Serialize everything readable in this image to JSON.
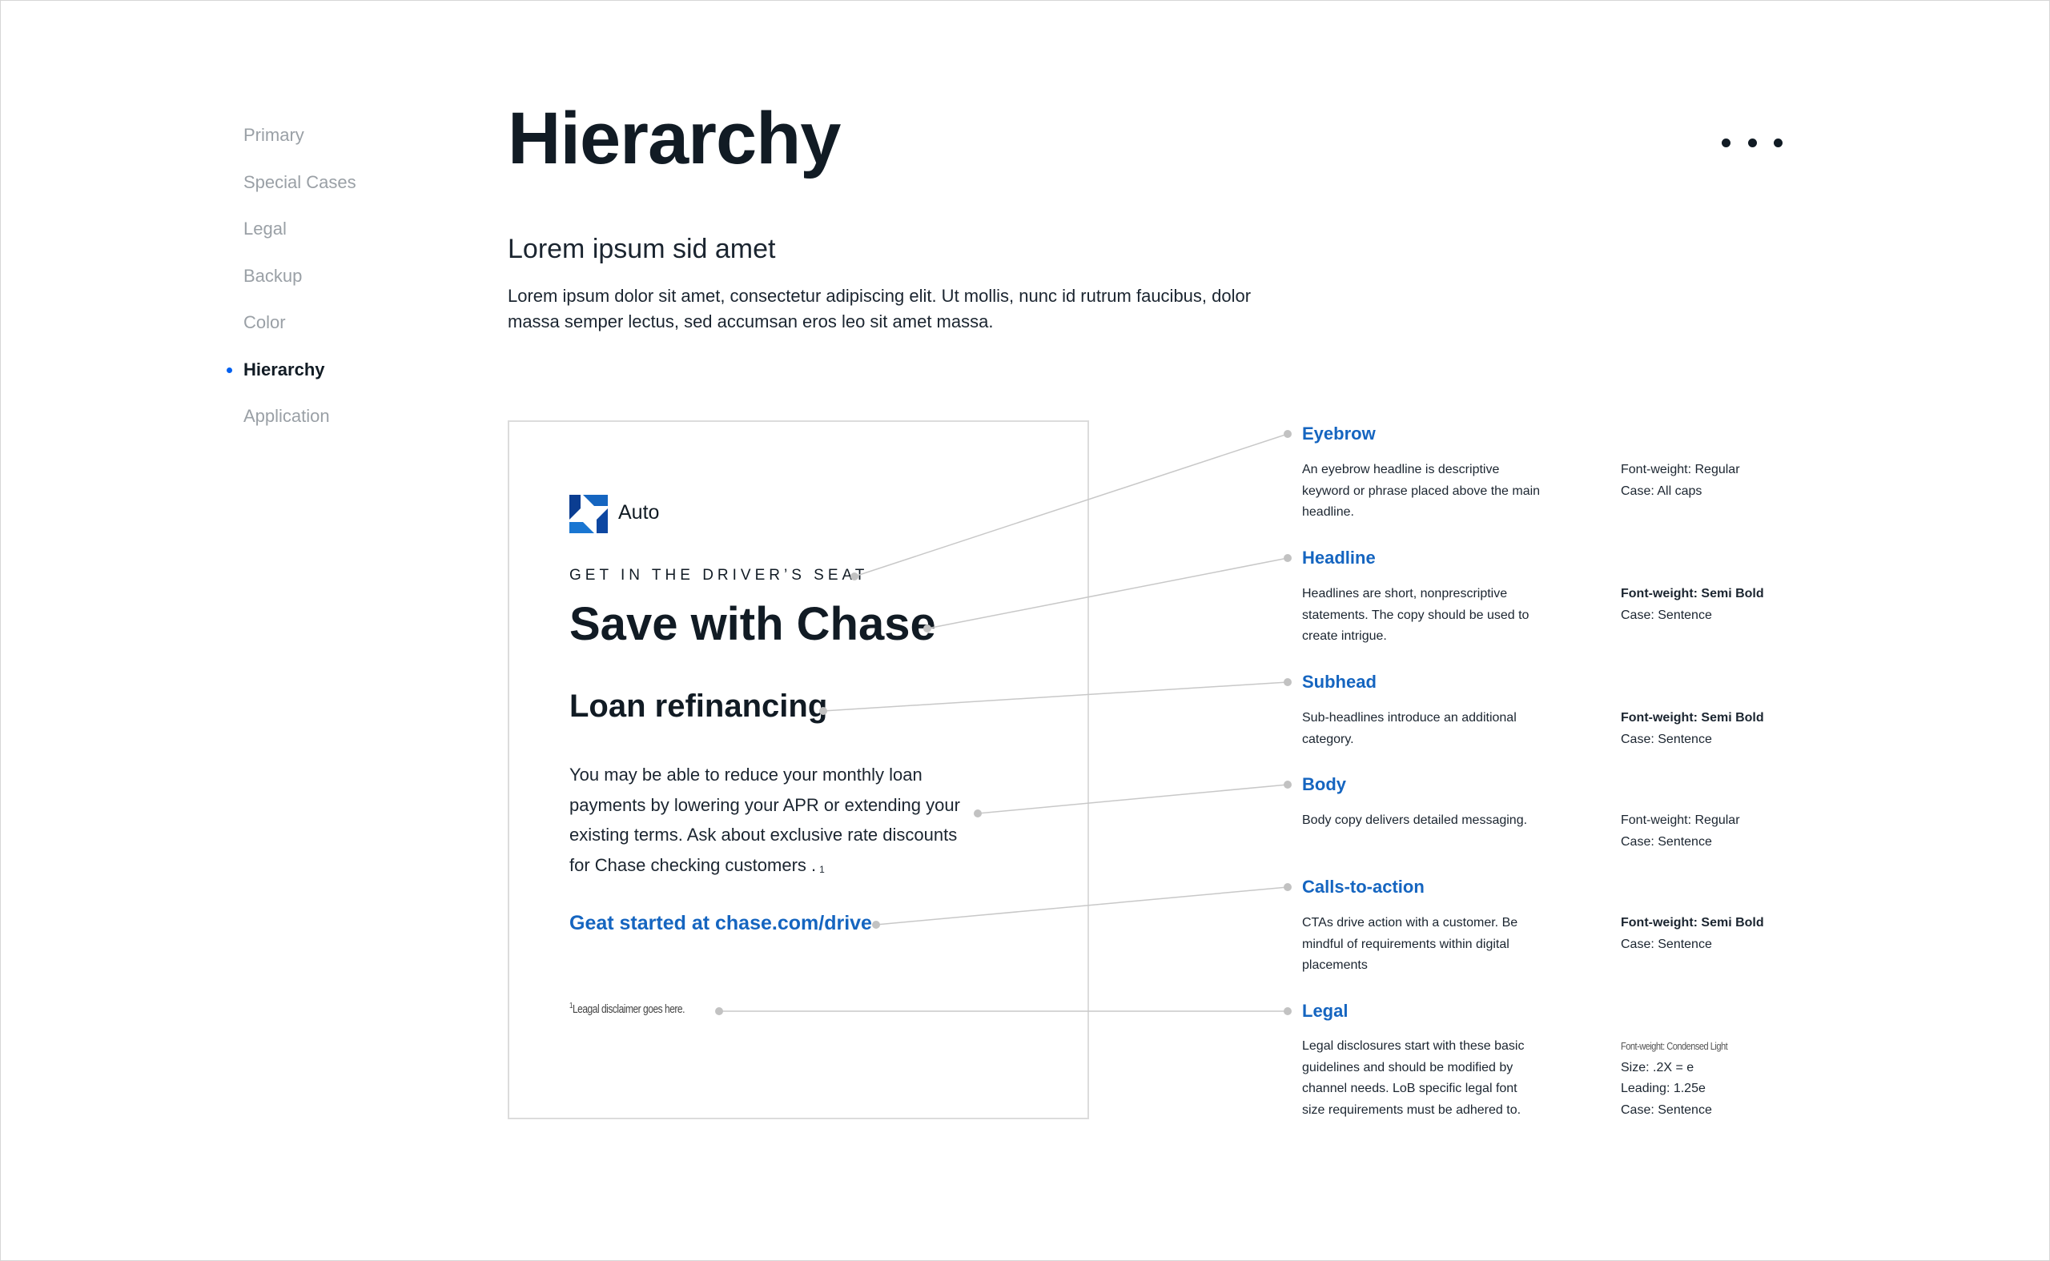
{
  "sidebar": {
    "items": [
      {
        "label": "Primary"
      },
      {
        "label": "Special Cases"
      },
      {
        "label": "Legal"
      },
      {
        "label": "Backup"
      },
      {
        "label": "Color"
      },
      {
        "label": "Hierarchy",
        "active": true
      },
      {
        "label": "Application"
      }
    ]
  },
  "header": {
    "title": "Hierarchy",
    "more_icon": "more-horizontal-icon"
  },
  "intro": {
    "subtitle": "Lorem ipsum sid amet",
    "body": "Lorem ipsum dolor sit amet, consectetur adipiscing elit. Ut mollis, nunc id rutrum faucibus, dolor massa semper lectus, sed accumsan eros leo sit amet massa."
  },
  "ad": {
    "logo_icon": "chase-octagon-logo-icon",
    "logo_label": "Auto",
    "eyebrow": "GET IN THE DRIVER’S SEAT",
    "headline": "Save with Chase",
    "subhead": "Loan refinancing",
    "body": "You may be able to reduce your monthly loan payments by lowering your APR or extending your existing terms. Ask about exclusive rate discounts for Chase checking customers .",
    "body_footnote": "1",
    "cta": "Geat started at chase.com/drive",
    "legal_marker": "1",
    "legal": "Leagal disclaimer goes here."
  },
  "annotations": [
    {
      "title": "Eyebrow",
      "desc": "An eyebrow headline is descriptive keyword or phrase placed above the main headline.",
      "spec": [
        {
          "text": "Font-weight: Regular",
          "style": "regular"
        },
        {
          "text": "Case: All caps",
          "style": "regular"
        }
      ]
    },
    {
      "title": "Headline",
      "desc": "Headlines are short, nonprescriptive statements. The copy should be used to create intrigue.",
      "spec": [
        {
          "text": "Font-weight: Semi Bold",
          "style": "strong"
        },
        {
          "text": "Case: Sentence",
          "style": "regular"
        }
      ]
    },
    {
      "title": "Subhead",
      "desc": "Sub-headlines introduce an additional category.",
      "spec": [
        {
          "text": "Font-weight: Semi Bold",
          "style": "strong"
        },
        {
          "text": "Case: Sentence",
          "style": "regular"
        }
      ]
    },
    {
      "title": "Body",
      "desc": "Body copy delivers detailed messaging.",
      "spec": [
        {
          "text": "Font-weight: Regular",
          "style": "regular"
        },
        {
          "text": "Case: Sentence",
          "style": "regular"
        }
      ]
    },
    {
      "title": "Calls-to-action",
      "desc": "CTAs drive action with a customer. Be mindful of requirements within digital placements",
      "spec": [
        {
          "text": "Font-weight: Semi Bold",
          "style": "strong"
        },
        {
          "text": "Case: Sentence",
          "style": "regular"
        }
      ]
    },
    {
      "title": "Legal",
      "desc": "Legal disclosures start with these basic guidelines and should be modified by channel needs. LoB specific legal font size requirements must be adhered to.",
      "spec": [
        {
          "text": "Font-weight: Condensed Light",
          "style": "condensed"
        },
        {
          "text": "Size: .2X = e",
          "style": "regular"
        },
        {
          "text": "Leading: 1.25e",
          "style": "regular"
        },
        {
          "text": "Case: Sentence",
          "style": "regular"
        }
      ]
    }
  ],
  "colors": {
    "accent": "#1565c0",
    "active_bullet": "#0060f0",
    "text_dark": "#111b24",
    "nav_inactive": "#9aa0a6",
    "connector": "#c8c8c8"
  }
}
